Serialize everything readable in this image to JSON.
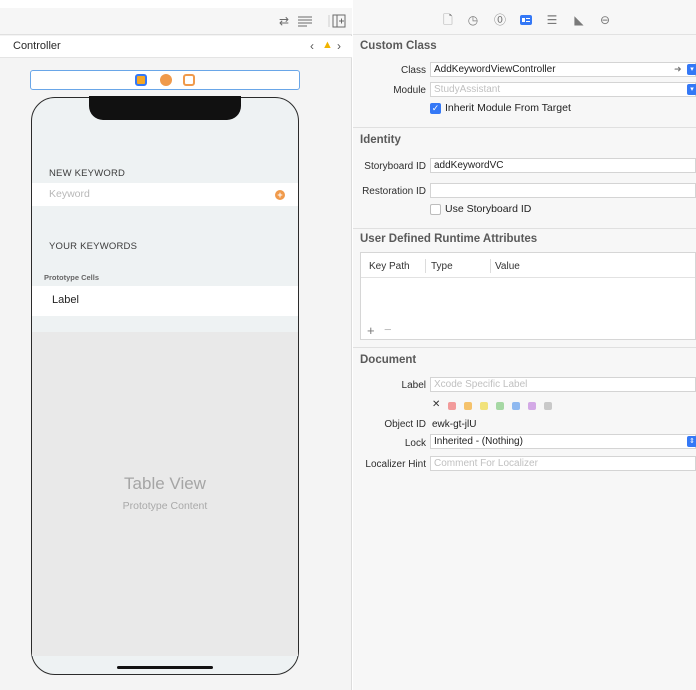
{
  "canvas": {
    "controller_label": "Controller",
    "new_keyword_header": "NEW KEYWORD",
    "keyword_placeholder": "Keyword",
    "add_symbol": "+",
    "your_keywords_header": "YOUR KEYWORDS",
    "prototype_cells_label": "Prototype Cells",
    "cell_label": "Label",
    "table_view_title": "Table View",
    "table_view_subtitle": "Prototype Content"
  },
  "inspector": {
    "custom_class": {
      "header": "Custom Class",
      "class_label": "Class",
      "class_value": "AddKeywordViewController",
      "module_label": "Module",
      "module_placeholder": "StudyAssistant",
      "inherit_label": "Inherit Module From Target",
      "inherit_checked": true
    },
    "identity": {
      "header": "Identity",
      "storyboard_id_label": "Storyboard ID",
      "storyboard_id_value": "addKeywordVC",
      "restoration_id_label": "Restoration ID",
      "restoration_id_value": "",
      "use_storyboard_id_label": "Use Storyboard ID",
      "use_storyboard_id_checked": false
    },
    "runtime_attributes": {
      "header": "User Defined Runtime Attributes",
      "columns": [
        "Key Path",
        "Type",
        "Value"
      ],
      "add_symbol": "+",
      "remove_symbol": "−"
    },
    "document": {
      "header": "Document",
      "label_label": "Label",
      "label_placeholder": "Xcode Specific Label",
      "clear_symbol": "✕",
      "swatch_colors": [
        "#f29b9b",
        "#f5c26b",
        "#f1e27a",
        "#a6d8a4",
        "#8fb9f0",
        "#d3a9e6",
        "#c9c9c9"
      ],
      "object_id_label": "Object ID",
      "object_id_value": "ewk-gt-jlU",
      "lock_label": "Lock",
      "lock_value": "Inherited - (Nothing)",
      "localizer_hint_label": "Localizer Hint",
      "localizer_hint_placeholder": "Comment For Localizer"
    }
  },
  "icons": {
    "toolbar_left": [
      "link-arrows-icon",
      "lines-icon",
      "add-panel-icon"
    ],
    "inspector_tabs": [
      "file-icon",
      "history-icon",
      "help-icon",
      "identity-icon",
      "attributes-icon",
      "size-icon",
      "connections-icon"
    ],
    "dock": [
      "view-controller-icon",
      "first-responder-icon",
      "exit-icon"
    ]
  },
  "colors": {
    "accent": "#3478f6",
    "warning": "#f1b400",
    "dock_orange": "#f09a4b"
  }
}
